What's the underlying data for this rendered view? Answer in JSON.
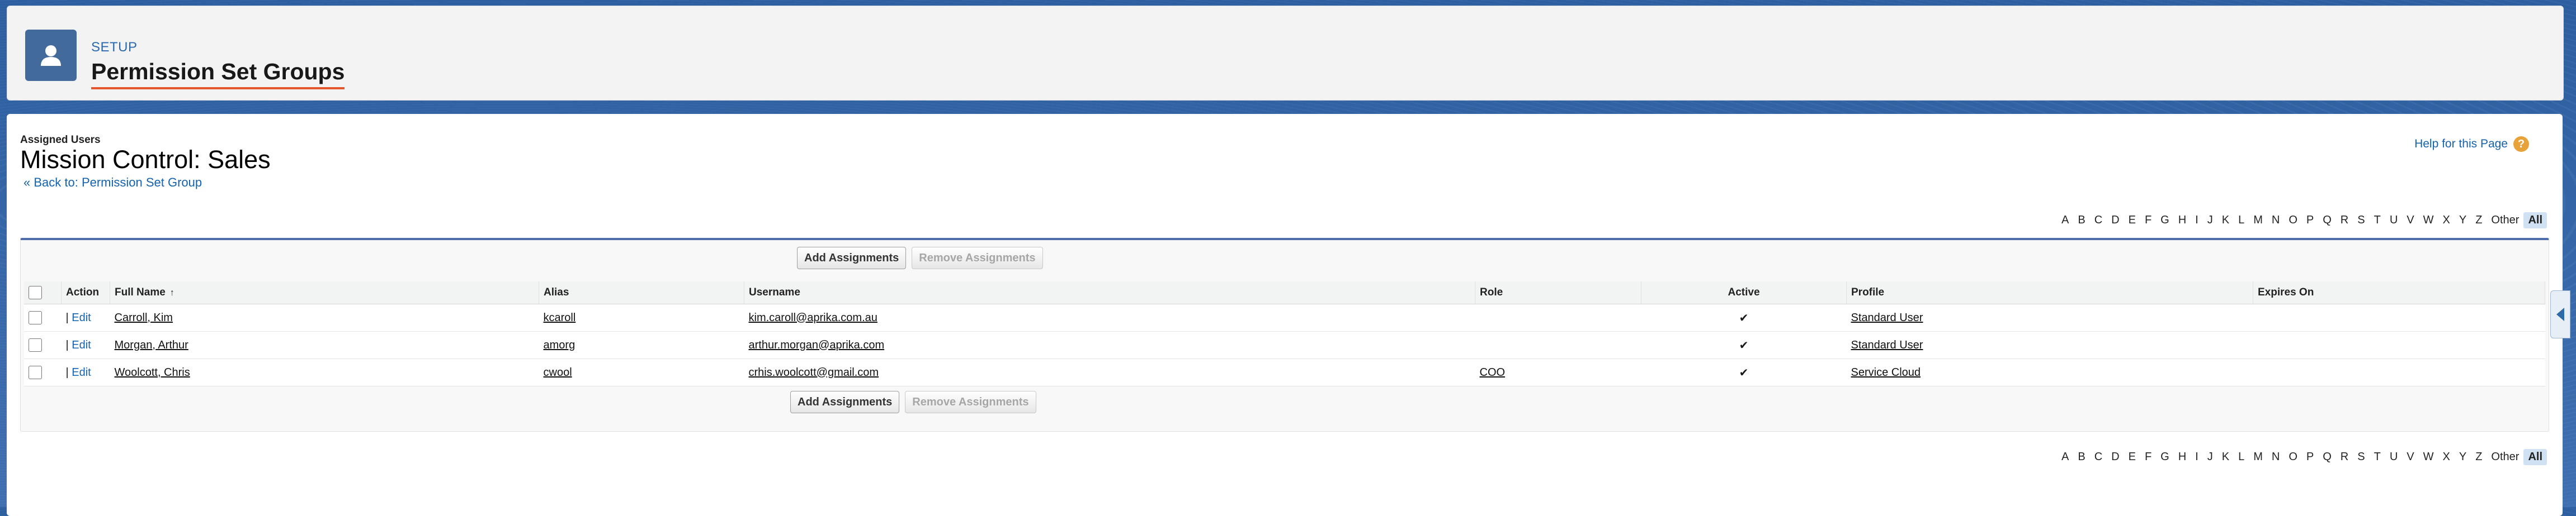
{
  "header": {
    "setup_label": "SETUP",
    "title": "Permission Set Groups",
    "icon": "user-icon"
  },
  "page": {
    "sub_label": "Assigned Users",
    "title": "Mission Control: Sales",
    "back_link": "« Back to: Permission Set Group",
    "help_link": "Help for this Page",
    "help_icon": "?"
  },
  "alphabet": [
    "A",
    "B",
    "C",
    "D",
    "E",
    "F",
    "G",
    "H",
    "I",
    "J",
    "K",
    "L",
    "M",
    "N",
    "O",
    "P",
    "Q",
    "R",
    "S",
    "T",
    "U",
    "V",
    "W",
    "X",
    "Y",
    "Z",
    "Other",
    "All"
  ],
  "alphabet_selected": "All",
  "buttons": {
    "add": "Add Assignments",
    "remove": "Remove Assignments"
  },
  "table": {
    "columns": {
      "action": "Action",
      "full_name": "Full Name",
      "sort_indicator": "↑",
      "alias": "Alias",
      "username": "Username",
      "role": "Role",
      "active": "Active",
      "profile": "Profile",
      "expires_on": "Expires On"
    },
    "rows": [
      {
        "edit": "Edit",
        "full_name": "Carroll, Kim",
        "alias": "kcaroll",
        "username": "kim.caroll@aprika.com.au",
        "role": "",
        "active": "✔",
        "profile": "Standard User",
        "expires_on": ""
      },
      {
        "edit": "Edit",
        "full_name": "Morgan, Arthur",
        "alias": "amorg",
        "username": "arthur.morgan@aprika.com",
        "role": "",
        "active": "✔",
        "profile": "Standard User",
        "expires_on": ""
      },
      {
        "edit": "Edit",
        "full_name": "Woolcott, Chris",
        "alias": "cwool",
        "username": "crhis.woolcott@gmail.com",
        "role": "COO",
        "active": "✔",
        "profile": "Service Cloud",
        "expires_on": ""
      }
    ]
  },
  "colors": {
    "accent": "#1562ad",
    "header_underline": "#e4572e",
    "icon_bg": "#426a9b"
  }
}
